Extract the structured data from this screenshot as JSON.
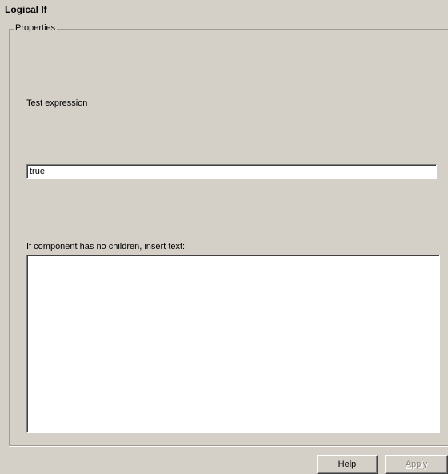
{
  "panel": {
    "title": "Logical If",
    "group_label": "Properties"
  },
  "test_expression": {
    "label": "Test expression",
    "value": "true"
  },
  "insert_text": {
    "label": "If component has no children, insert text:",
    "value": ""
  },
  "buttons": {
    "help": {
      "mnemonic": "H",
      "rest": "elp",
      "enabled": true
    },
    "apply": {
      "mnemonic": "A",
      "rest": "pply",
      "enabled": false
    }
  },
  "colors": {
    "background": "#d4d0c8",
    "field_background": "#ffffff",
    "disabled_text": "#8a877f"
  }
}
